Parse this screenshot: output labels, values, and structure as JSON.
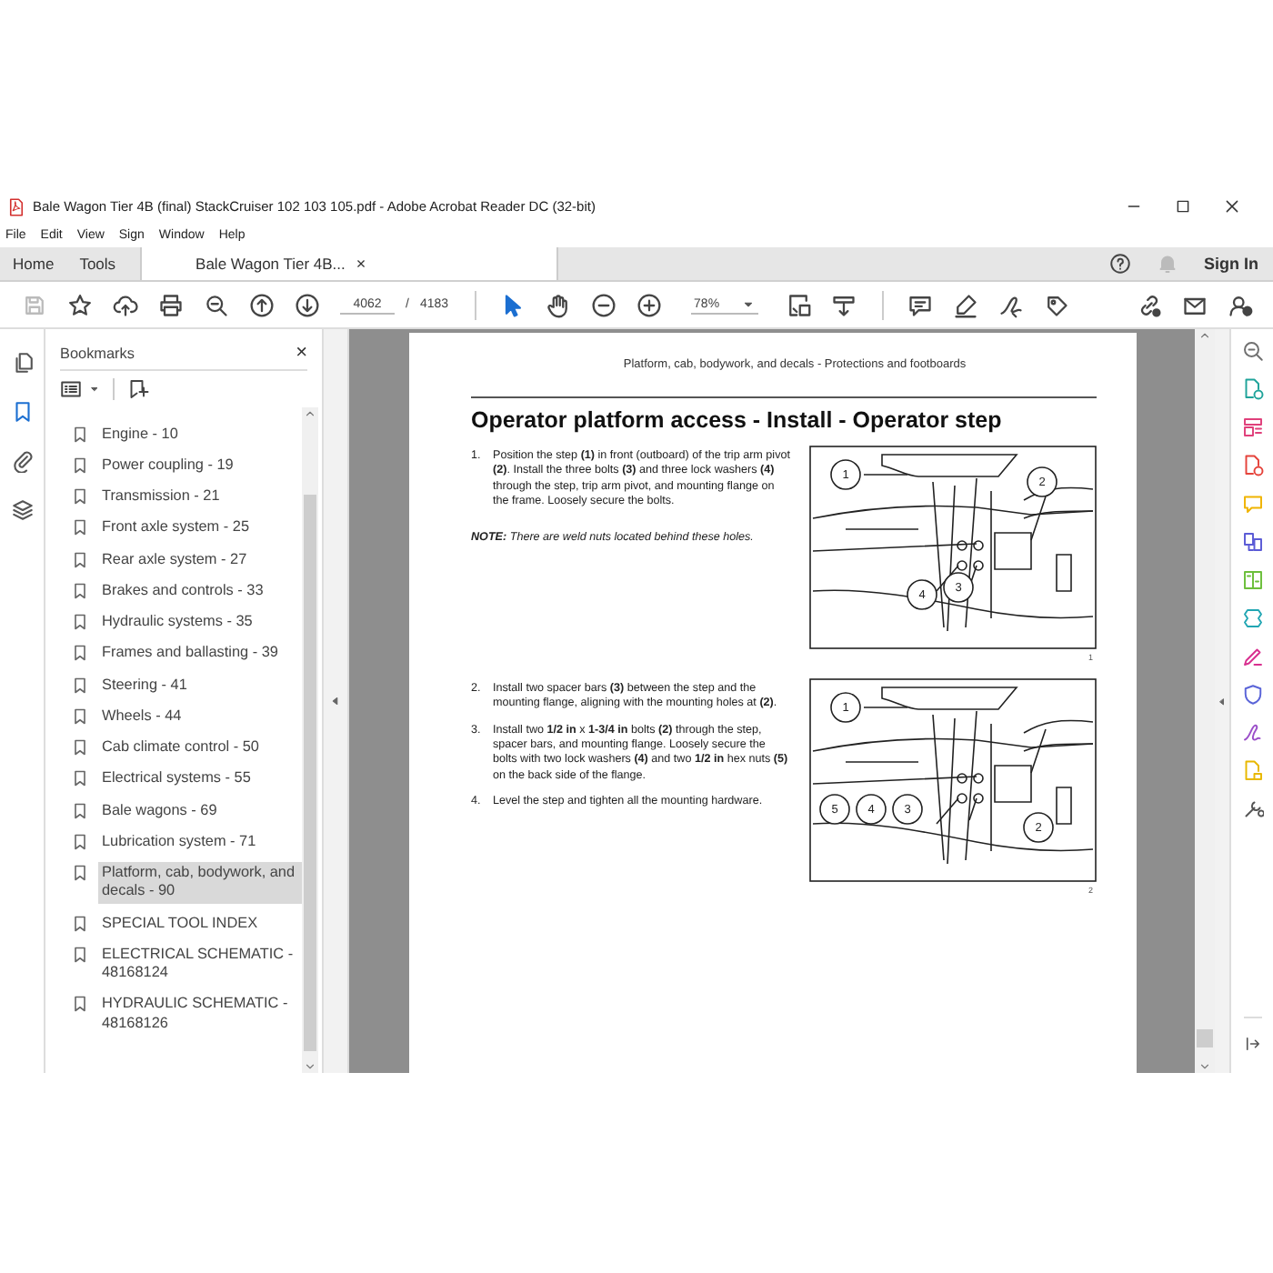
{
  "window": {
    "title": "Bale Wagon Tier 4B (final) StackCruiser 102 103 105.pdf - Adobe Acrobat Reader DC (32-bit)"
  },
  "menu": [
    "File",
    "Edit",
    "View",
    "Sign",
    "Window",
    "Help"
  ],
  "tabs": [
    {
      "label": "Home",
      "selected": false
    },
    {
      "label": "Tools",
      "selected": false
    },
    {
      "label": "Bale Wagon Tier 4B...",
      "selected": true,
      "close": "×"
    }
  ],
  "account": {
    "sign_in": "Sign In"
  },
  "toolbar": {
    "save": {
      "disabled": true
    },
    "select_tool": {
      "selected": true
    },
    "hand_tool": {
      "selected": false
    },
    "page": "4062",
    "separator": "/",
    "page_total": "4183",
    "zoom": "78%"
  },
  "nav_rail": [
    {
      "selected": false
    },
    {
      "selected": true
    },
    {
      "selected": false
    },
    {
      "selected": false
    }
  ],
  "bookmarks": {
    "title": "Bookmarks",
    "close": "×",
    "items": [
      {
        "label": "Engine - 10",
        "selected": false
      },
      {
        "label": "Power coupling - 19",
        "selected": false
      },
      {
        "label": "Transmission - 21",
        "selected": false
      },
      {
        "label": "Front axle system - 25",
        "selected": false
      },
      {
        "label": "Rear axle system - 27",
        "selected": false
      },
      {
        "label": "Brakes and controls - 33",
        "selected": false
      },
      {
        "label": "Hydraulic systems - 35",
        "selected": false
      },
      {
        "label": "Frames and ballasting - 39",
        "selected": false
      },
      {
        "label": "Steering - 41",
        "selected": false
      },
      {
        "label": "Wheels - 44",
        "selected": false
      },
      {
        "label": "Cab climate control - 50",
        "selected": false
      },
      {
        "label": "Electrical systems - 55",
        "selected": false
      },
      {
        "label": "Bale wagons - 69",
        "selected": false
      },
      {
        "label": "Lubrication system - 71",
        "selected": false
      },
      {
        "label": "Platform, cab, bodywork, and decals - 90",
        "selected": true
      },
      {
        "label": "SPECIAL TOOL INDEX",
        "selected": false
      },
      {
        "label": "ELECTRICAL SCHEMATIC - 48168124",
        "selected": false
      },
      {
        "label": "HYDRAULIC SCHEMATIC - 48168126",
        "selected": false
      }
    ]
  },
  "document": {
    "running_head": "Platform, cab, bodywork, and decals - Protections and footboards",
    "title": "Operator platform access - Install - Operator step",
    "sections": [
      {
        "steps": [
          {
            "number": "1.",
            "text": "Position the step **(1)** in front (outboard) of the trip arm pivot **(2)**. Install the three bolts **(3)** and three lock washers **(4)** through the step, trip arm pivot, and mounting flange on the frame. Loosely secure the bolts."
          }
        ],
        "note": "**NOTE:** There are weld nuts located behind these holes.",
        "figure": {
          "callouts": [
            "1",
            "2",
            "4",
            "3"
          ],
          "number": "1"
        }
      },
      {
        "steps": [
          {
            "number": "2.",
            "text": "Install two spacer bars **(3)** between the step and the mounting flange, aligning with the mounting holes at **(2)**."
          },
          {
            "number": "3.",
            "text": "Install two **1/2 in** x **1-3/4 in** bolts **(2)** through the step, spacer bars, and mounting flange. Loosely secure the bolts with two lock washers **(4)** and two **1/2 in** hex nuts **(5)** on the back side of the flange."
          },
          {
            "number": "4.",
            "text": "Level the step and tighten all the mounting hardware."
          }
        ],
        "figure": {
          "callouts": [
            "1",
            "5",
            "4",
            "3",
            "2"
          ],
          "number": "2"
        }
      }
    ]
  },
  "tools_rail": [
    {
      "color": "#707070"
    },
    {
      "color": "#1fa39a"
    },
    {
      "color": "#e0407b"
    },
    {
      "color": "#e5433b"
    },
    {
      "color": "#f0b400"
    },
    {
      "color": "#5b5bd6"
    },
    {
      "color": "#6cbf3b"
    },
    {
      "color": "#22a6b3"
    },
    {
      "color": "#d8308f"
    },
    {
      "color": "#5a64d8"
    },
    {
      "color": "#9b4fc9"
    },
    {
      "color": "#e8b800"
    },
    {
      "color": "#555555"
    }
  ]
}
